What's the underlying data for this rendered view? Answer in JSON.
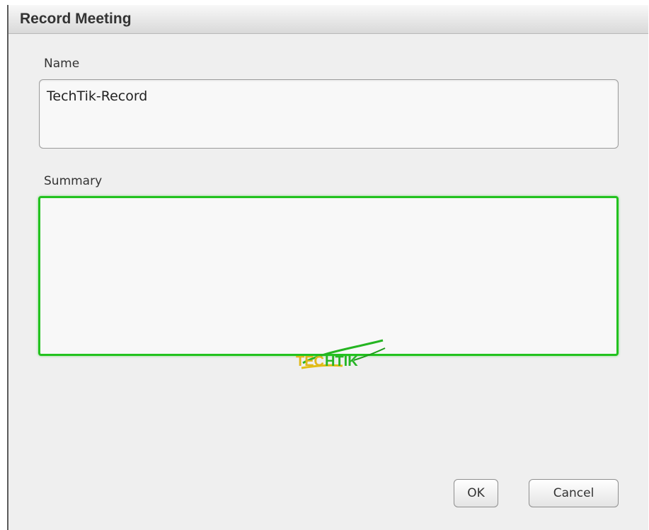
{
  "dialog": {
    "title": "Record Meeting"
  },
  "fields": {
    "name": {
      "label": "Name",
      "value": "TechTik-Record"
    },
    "summary": {
      "label": "Summary",
      "value": ""
    }
  },
  "buttons": {
    "ok_label": "OK",
    "cancel_label": "Cancel"
  },
  "watermark": {
    "text": "TECHTIK"
  },
  "colors": {
    "focus_border": "#23c21f",
    "dialog_bg": "#efefef"
  }
}
